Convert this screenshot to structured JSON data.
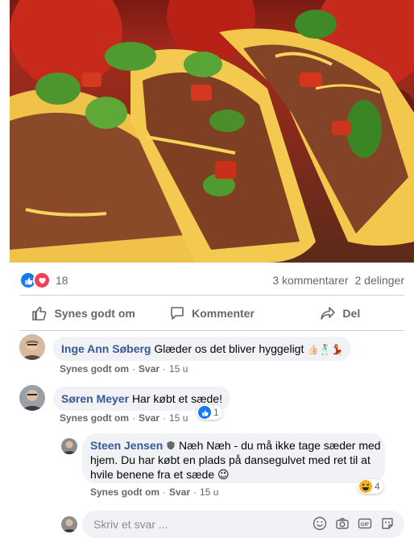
{
  "post": {
    "image_alt": "tacos",
    "reaction_count": "18",
    "comments_count": "3 kommentarer",
    "shares_count": "2 delinger"
  },
  "actions": {
    "like": "Synes godt om",
    "comment": "Kommenter",
    "share": "Del"
  },
  "comments": [
    {
      "author": "Inge Ann Søberg",
      "text": "Glæder os det bliver hyggeligt",
      "emojis": "👍🏻🕺💃",
      "like_label": "Synes godt om",
      "reply_label": "Svar",
      "time": "15 u"
    },
    {
      "author": "Søren Meyer",
      "text": "Har købt et sæde!",
      "like_label": "Synes godt om",
      "reply_label": "Svar",
      "time": "15 u",
      "reaction_count": "1"
    }
  ],
  "reply": {
    "author": "Steen Jensen",
    "text_line1": "Næh Næh - du må ikke tage sæder med",
    "text_line2": "hjem. Du har købt en plads på dansegulvet med ret til at",
    "text_line3": "hvile benene fra et sæde",
    "emoji": "😉",
    "like_label": "Synes godt om",
    "reply_label": "Svar",
    "time": "15 u",
    "reaction_count": "4"
  },
  "reply_input": {
    "placeholder": "Skriv et svar ..."
  },
  "colors": {
    "like_blue": "#1877f2",
    "love_red": "#f33e58",
    "author_link": "#385898",
    "meta_gray": "#65676b",
    "bubble_bg": "#f0f2f5"
  }
}
